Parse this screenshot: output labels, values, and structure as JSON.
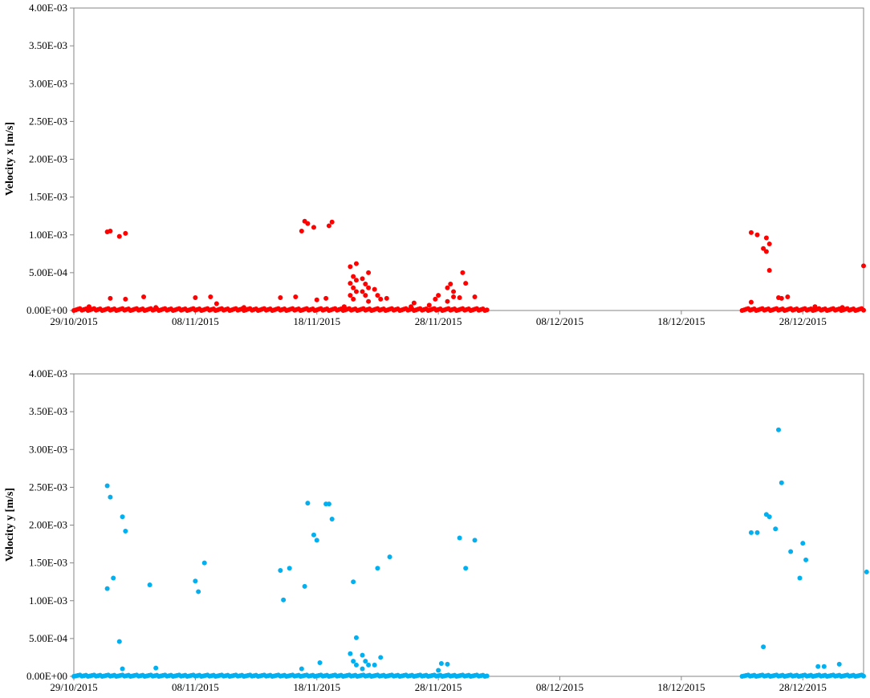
{
  "colors": {
    "series_x": "#ff0000",
    "series_y": "#00b0f0",
    "axis": "#868686"
  },
  "chart_data": [
    {
      "type": "scatter",
      "ylabel": "Velocity x  [m/s]",
      "xlabel": "",
      "x_ticks": [
        "29/10/2015",
        "08/11/2015",
        "18/11/2015",
        "28/11/2015",
        "08/12/2015",
        "18/12/2015",
        "28/12/2015"
      ],
      "y_ticks": [
        "0.00E+00",
        "5.00E-04",
        "1.00E-03",
        "1.50E-03",
        "2.00E-03",
        "2.50E-03",
        "3.00E-03",
        "3.50E-03",
        "4.00E-03"
      ],
      "xlim": [
        "2015-10-29",
        "2016-01-02"
      ],
      "ylim": [
        0,
        0.004
      ],
      "grid": false,
      "series": [
        {
          "color": "#ff0000",
          "points": [
            [
              "2015-11-01",
              0.00104
            ],
            [
              "2015-11-01",
              0.00105
            ],
            [
              "2015-11-02",
              0.00102
            ],
            [
              "2015-11-02",
              0.00098
            ],
            [
              "2015-11-01",
              0.00016
            ],
            [
              "2015-11-02",
              0.00015
            ],
            [
              "2015-11-04",
              0.00018
            ],
            [
              "2015-11-08",
              0.00017
            ],
            [
              "2015-11-09",
              0.00018
            ],
            [
              "2015-11-10",
              9e-05
            ],
            [
              "2015-11-15",
              0.00017
            ],
            [
              "2015-11-16",
              0.00018
            ],
            [
              "2015-11-17",
              0.00105
            ],
            [
              "2015-11-17",
              0.00118
            ],
            [
              "2015-11-17",
              0.00115
            ],
            [
              "2015-11-18",
              0.0011
            ],
            [
              "2015-11-19",
              0.00112
            ],
            [
              "2015-11-19",
              0.00117
            ],
            [
              "2015-11-19",
              0.00016
            ],
            [
              "2015-11-18",
              0.00014
            ],
            [
              "2015-11-21",
              0.00062
            ],
            [
              "2015-11-21",
              0.00058
            ],
            [
              "2015-11-21",
              0.00045
            ],
            [
              "2015-11-21",
              0.0004
            ],
            [
              "2015-11-21",
              0.00036
            ],
            [
              "2015-11-21",
              0.0003
            ],
            [
              "2015-11-21",
              0.00025
            ],
            [
              "2015-11-21",
              0.0002
            ],
            [
              "2015-11-21",
              0.00015
            ],
            [
              "2015-11-22",
              0.0005
            ],
            [
              "2015-11-22",
              0.00042
            ],
            [
              "2015-11-22",
              0.00035
            ],
            [
              "2015-11-22",
              0.0003
            ],
            [
              "2015-11-22",
              0.00025
            ],
            [
              "2015-11-22",
              0.0002
            ],
            [
              "2015-11-22",
              0.00012
            ],
            [
              "2015-11-23",
              0.00028
            ],
            [
              "2015-11-23",
              0.0002
            ],
            [
              "2015-11-23",
              0.00015
            ],
            [
              "2015-11-24",
              0.00016
            ],
            [
              "2015-11-26",
              0.0001
            ],
            [
              "2015-11-27",
              7e-05
            ],
            [
              "2015-11-28",
              0.00015
            ],
            [
              "2015-11-28",
              0.0002
            ],
            [
              "2015-11-29",
              0.00025
            ],
            [
              "2015-11-29",
              0.0003
            ],
            [
              "2015-11-29",
              0.00035
            ],
            [
              "2015-11-29",
              0.00018
            ],
            [
              "2015-11-29",
              0.00012
            ],
            [
              "2015-11-30",
              0.0005
            ],
            [
              "2015-11-30",
              0.00036
            ],
            [
              "2015-11-30",
              0.00017
            ],
            [
              "2015-12-01",
              0.00018
            ],
            [
              "2015-12-24",
              0.001
            ],
            [
              "2015-12-24",
              0.00103
            ],
            [
              "2015-12-25",
              0.00096
            ],
            [
              "2015-12-25",
              0.00088
            ],
            [
              "2015-12-25",
              0.00082
            ],
            [
              "2015-12-25",
              0.00078
            ],
            [
              "2015-12-25",
              0.00053
            ],
            [
              "2015-12-24",
              0.00011
            ],
            [
              "2015-12-26",
              0.00017
            ],
            [
              "2015-12-26",
              0.00016
            ],
            [
              "2015-12-27",
              0.00018
            ],
            [
              "2016-01-02",
              0.00059
            ],
            [
              "2015-10-30",
              5e-05
            ],
            [
              "2015-11-05",
              4e-05
            ],
            [
              "2015-11-12",
              4e-05
            ],
            [
              "2015-11-20",
              5e-05
            ],
            [
              "2015-11-26",
              5e-05
            ],
            [
              "2015-12-29",
              5e-05
            ],
            [
              "2015-12-31",
              4e-05
            ]
          ],
          "baseline_ranges": [
            [
              "2015-10-29",
              "2015-12-02",
              3e-05
            ],
            [
              "2015-12-23",
              "2016-01-02",
              3e-05
            ]
          ]
        }
      ]
    },
    {
      "type": "scatter",
      "ylabel": "Velocity y  [m/s]",
      "xlabel": "",
      "x_ticks": [
        "29/10/2015",
        "08/11/2015",
        "18/11/2015",
        "28/11/2015",
        "08/12/2015",
        "18/12/2015",
        "28/12/2015"
      ],
      "y_ticks": [
        "0.00E+00",
        "5.00E-04",
        "1.00E-03",
        "1.50E-03",
        "2.00E-03",
        "2.50E-03",
        "3.00E-03",
        "3.50E-03",
        "4.00E-03"
      ],
      "xlim": [
        "2015-10-29",
        "2016-01-02"
      ],
      "ylim": [
        0,
        0.004
      ],
      "grid": false,
      "series": [
        {
          "color": "#00b0f0",
          "points": [
            [
              "2015-11-01",
              0.00252
            ],
            [
              "2015-11-01",
              0.00237
            ],
            [
              "2015-11-01",
              0.0013
            ],
            [
              "2015-11-01",
              0.00116
            ],
            [
              "2015-11-02",
              0.00211
            ],
            [
              "2015-11-02",
              0.00192
            ],
            [
              "2015-11-02",
              0.00046
            ],
            [
              "2015-11-02",
              0.0001
            ],
            [
              "2015-11-04",
              0.00121
            ],
            [
              "2015-11-05",
              0.00011
            ],
            [
              "2015-11-08",
              0.00126
            ],
            [
              "2015-11-08",
              0.00112
            ],
            [
              "2015-11-09",
              0.0015
            ],
            [
              "2015-11-15",
              0.0014
            ],
            [
              "2015-11-15",
              0.00101
            ],
            [
              "2015-11-16",
              0.00143
            ],
            [
              "2015-11-17",
              0.00119
            ],
            [
              "2015-11-17",
              0.00229
            ],
            [
              "2015-11-18",
              0.00187
            ],
            [
              "2015-11-18",
              0.0018
            ],
            [
              "2015-11-18",
              0.00018
            ],
            [
              "2015-11-19",
              0.00228
            ],
            [
              "2015-11-19",
              0.00228
            ],
            [
              "2015-11-19",
              0.00208
            ],
            [
              "2015-11-17",
              0.0001
            ],
            [
              "2015-11-21",
              0.00125
            ],
            [
              "2015-11-21",
              0.00051
            ],
            [
              "2015-11-21",
              0.0003
            ],
            [
              "2015-11-21",
              0.0002
            ],
            [
              "2015-11-21",
              0.00015
            ],
            [
              "2015-11-22",
              0.00028
            ],
            [
              "2015-11-22",
              0.0002
            ],
            [
              "2015-11-22",
              0.00015
            ],
            [
              "2015-11-22",
              0.0001
            ],
            [
              "2015-11-23",
              0.00143
            ],
            [
              "2015-11-23",
              0.00025
            ],
            [
              "2015-11-23",
              0.00015
            ],
            [
              "2015-11-24",
              0.00158
            ],
            [
              "2015-11-28",
              0.00017
            ],
            [
              "2015-11-29",
              0.00016
            ],
            [
              "2015-11-28",
              8e-05
            ],
            [
              "2015-11-30",
              0.00143
            ],
            [
              "2015-11-30",
              0.00183
            ],
            [
              "2015-12-01",
              0.0018
            ],
            [
              "2015-12-24",
              0.0019
            ],
            [
              "2015-12-24",
              0.0019
            ],
            [
              "2015-12-25",
              0.00214
            ],
            [
              "2015-12-25",
              0.00211
            ],
            [
              "2015-12-25",
              0.00039
            ],
            [
              "2015-12-26",
              0.00326
            ],
            [
              "2015-12-26",
              0.00256
            ],
            [
              "2015-12-26",
              0.00195
            ],
            [
              "2015-12-27",
              0.00165
            ],
            [
              "2015-12-28",
              0.00154
            ],
            [
              "2015-12-28",
              0.0013
            ],
            [
              "2015-12-28",
              0.00176
            ],
            [
              "2015-12-29",
              0.00013
            ],
            [
              "2015-12-30",
              0.00013
            ],
            [
              "2015-12-31",
              0.00016
            ],
            [
              "2016-01-02",
              0.00138
            ]
          ],
          "baseline_ranges": [
            [
              "2015-10-29",
              "2015-12-02",
              2e-05
            ],
            [
              "2015-12-23",
              "2016-01-02",
              2e-05
            ]
          ]
        }
      ]
    }
  ]
}
